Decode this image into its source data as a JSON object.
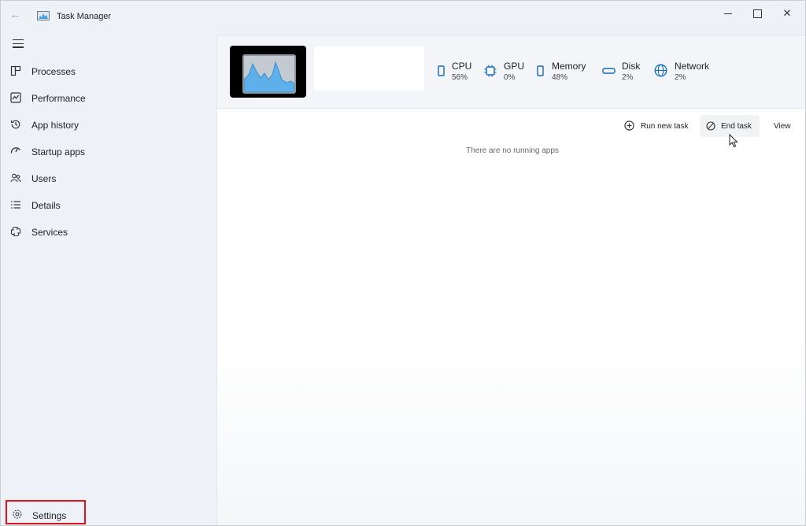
{
  "window": {
    "title": "Task Manager"
  },
  "sidebar": {
    "items": [
      {
        "label": "Processes",
        "icon": "processes-icon"
      },
      {
        "label": "Performance",
        "icon": "performance-icon"
      },
      {
        "label": "App history",
        "icon": "history-icon"
      },
      {
        "label": "Startup apps",
        "icon": "startup-icon"
      },
      {
        "label": "Users",
        "icon": "users-icon"
      },
      {
        "label": "Details",
        "icon": "details-icon"
      },
      {
        "label": "Services",
        "icon": "services-icon"
      }
    ],
    "settings_label": "Settings"
  },
  "metrics": [
    {
      "name": "CPU",
      "value": "56%"
    },
    {
      "name": "GPU",
      "value": "0%"
    },
    {
      "name": "Memory",
      "value": "48%"
    },
    {
      "name": "Disk",
      "value": "2%"
    },
    {
      "name": "Network",
      "value": "2%"
    }
  ],
  "toolbar": {
    "run_new_task": "Run new task",
    "end_task": "End task",
    "view": "View"
  },
  "main": {
    "empty_message": "There are no running apps"
  },
  "colors": {
    "accent": "#0f6cbd",
    "highlight_box": "#e3121f"
  }
}
